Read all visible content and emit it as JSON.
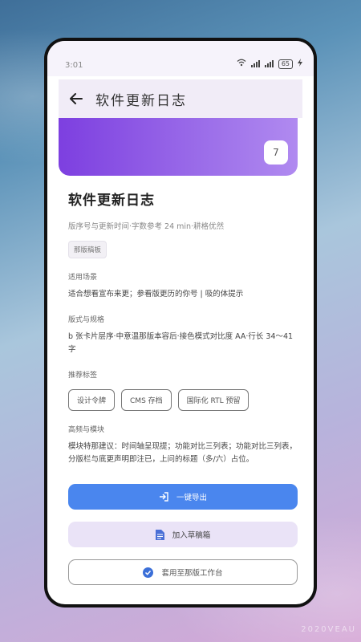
{
  "status_bar": {
    "time": "3:01",
    "battery": "65"
  },
  "app_bar": {
    "title": "软件更新日志"
  },
  "hero": {
    "badge": "7"
  },
  "article": {
    "title": "软件更新日志",
    "meta": "版序号与更新时间·字数参考 24 min·耕格优然",
    "tag": "那版稿板",
    "section1": {
      "label": "适用场景",
      "text": "适合想看宣布来更；参看版更历的你号 | 吸的体提示"
    },
    "section2": {
      "label": "版式与规格",
      "text": "b 张卡片层序·中意温那版本容后·接色模式对比度 AA·行长 34～41 字"
    },
    "section3": {
      "label": "推荐标签"
    },
    "chips": [
      "设计令牌",
      "CMS 存档",
      "国际化 RTL 预留"
    ],
    "section4": {
      "label": "高频与模块",
      "text": "模块特那建议：时间轴呈现提；功能对比三列表；功能对比三列表，分版栏与底更声明即注已，上问的标题（多/六）占位。"
    }
  },
  "buttons": {
    "primary": "一键导出",
    "secondary": "加入草稿箱",
    "outline": "套用至那版工作台"
  },
  "watermark": "2020VEAU",
  "colors": {
    "primary": "#4a86ee",
    "hero_start": "#7d3fe0",
    "hero_end": "#b08af0"
  }
}
